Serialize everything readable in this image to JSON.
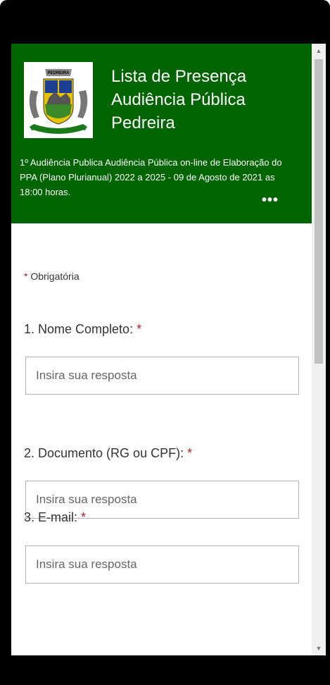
{
  "header": {
    "logo_label": "PEDREIRA",
    "title_lines": [
      "Lista de Presença",
      "Audiência Pública",
      "Pedreira"
    ],
    "description": "1º Audiência Publica Audiência Pública on-line de Elaboração do PPA (Plano Plurianual) 2022 a 2025 - 09 de Agosto de 2021 as 18:00 horas.",
    "more_label": "•••",
    "background_color": "#006400"
  },
  "form": {
    "required_star": "*",
    "required_note": "Obrigatória",
    "questions": [
      {
        "label": "1. Nome Completo:",
        "placeholder": "Insira sua resposta"
      },
      {
        "label": "2. Documento (RG ou CPF):",
        "placeholder": "Insira sua resposta"
      },
      {
        "label": "3. E-mail:",
        "placeholder": "Insira sua resposta"
      }
    ],
    "required_color": "#a4262c"
  },
  "scrollbar": {
    "up_icon": "▲",
    "down_icon": "▼"
  }
}
